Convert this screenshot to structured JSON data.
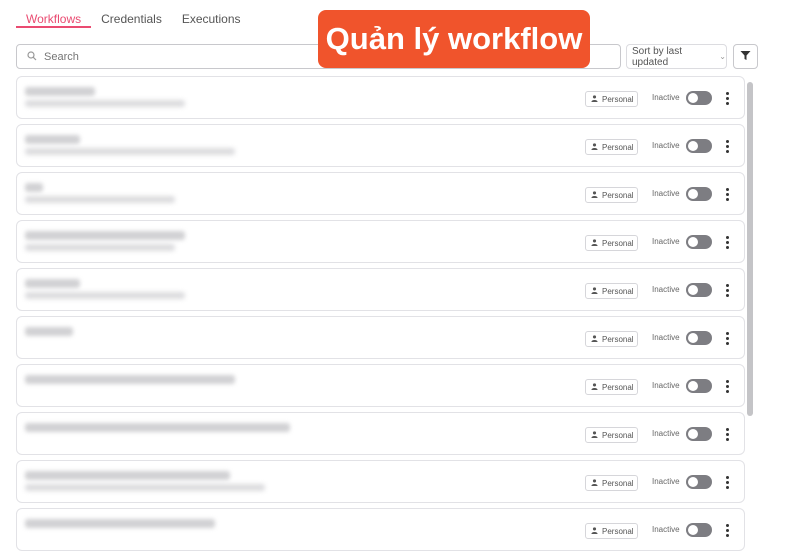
{
  "tabs": [
    {
      "label": "Workflows",
      "active": true
    },
    {
      "label": "Credentials",
      "active": false
    },
    {
      "label": "Executions",
      "active": false
    }
  ],
  "search": {
    "placeholder": "Search",
    "value": ""
  },
  "sort": {
    "selected": "Sort by last updated"
  },
  "callout": {
    "text": "Quản lý workflow",
    "color": "#f0542c"
  },
  "accent_color": "#ea4b71",
  "workflows": [
    {
      "badge": "Personal",
      "status": "Inactive",
      "active": false
    },
    {
      "badge": "Personal",
      "status": "Inactive",
      "active": false
    },
    {
      "badge": "Personal",
      "status": "Inactive",
      "active": false
    },
    {
      "badge": "Personal",
      "status": "Inactive",
      "active": false
    },
    {
      "badge": "Personal",
      "status": "Inactive",
      "active": false
    },
    {
      "badge": "Personal",
      "status": "Inactive",
      "active": false
    },
    {
      "badge": "Personal",
      "status": "Inactive",
      "active": false
    },
    {
      "badge": "Personal",
      "status": "Inactive",
      "active": false
    },
    {
      "badge": "Personal",
      "status": "Inactive",
      "active": false
    },
    {
      "badge": "Personal",
      "status": "Inactive",
      "active": false
    }
  ]
}
